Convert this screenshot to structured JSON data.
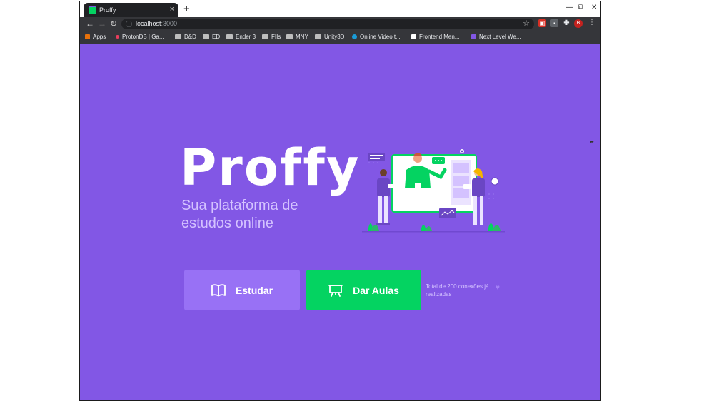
{
  "browser": {
    "tab_title": "Proffy",
    "tab_close": "×",
    "new_tab": "+",
    "url_host": "localhost",
    "url_port": ":3000",
    "avatar_letter": "B",
    "window_controls": {
      "minimize": "—",
      "maximize": "⧉",
      "close": "✕"
    },
    "nav": {
      "back": "←",
      "forward": "→",
      "reload": "↻"
    }
  },
  "bookmarks": [
    {
      "label": "Apps",
      "icon": "apps-grid-icon",
      "color": "#e8710a"
    },
    {
      "label": "ProtonDB | Ga...",
      "icon": "protondb-icon",
      "color": "#ea3d5c"
    },
    {
      "label": "D&D",
      "icon": "folder-icon",
      "color": "#bdbdbd"
    },
    {
      "label": "ED",
      "icon": "folder-icon",
      "color": "#bdbdbd"
    },
    {
      "label": "Ender 3",
      "icon": "folder-icon",
      "color": "#bdbdbd"
    },
    {
      "label": "FIIs",
      "icon": "folder-icon",
      "color": "#bdbdbd"
    },
    {
      "label": "MNY",
      "icon": "folder-icon",
      "color": "#bdbdbd"
    },
    {
      "label": "Unity3D",
      "icon": "folder-icon",
      "color": "#bdbdbd"
    },
    {
      "label": "Online Video t...",
      "icon": "video-icon",
      "color": "#1a9bd7"
    },
    {
      "label": "Frontend Men...",
      "icon": "frontend-mentor-icon",
      "color": "#ffffff"
    },
    {
      "label": "Next Level We...",
      "icon": "rocketseat-icon",
      "color": "#8257e5"
    }
  ],
  "landing": {
    "logo": "Proffy",
    "tagline": "Sua plataforma de estudos online",
    "study_button": "Estudar",
    "give_classes_button": "Dar Aulas",
    "connections_text": "Total de 200 conexões já realizadas"
  },
  "colors": {
    "primary": "#8257e5",
    "primary_light": "#9871f5",
    "secondary": "#04d361",
    "text_light": "#d4c2ff"
  }
}
